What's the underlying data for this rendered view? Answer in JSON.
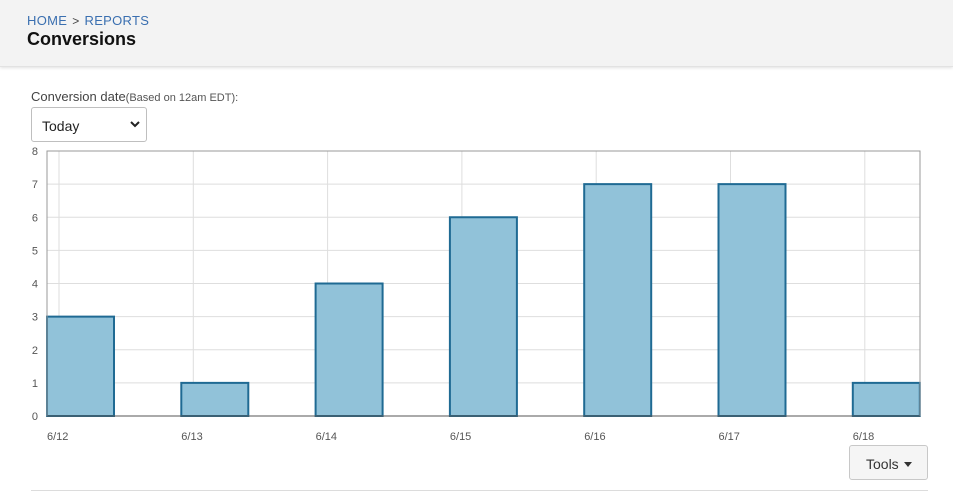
{
  "breadcrumb": {
    "home": "HOME",
    "separator": ">",
    "reports": "REPORTS"
  },
  "page": {
    "title": "Conversions"
  },
  "filter": {
    "label": "Conversion date",
    "note": "(Based on 12am EDT):",
    "selected": "Today"
  },
  "tools": {
    "label": "Tools"
  },
  "colors": {
    "bar_fill": "#91c2d9",
    "bar_stroke": "#1f6a93",
    "link": "#3a6fb0"
  },
  "chart_data": {
    "type": "bar",
    "categories": [
      "6/12",
      "6/13",
      "6/14",
      "6/15",
      "6/16",
      "6/17",
      "6/18"
    ],
    "values": [
      3,
      1,
      4,
      6,
      7,
      7,
      1
    ],
    "ylim": [
      0,
      8
    ],
    "yticks": [
      0,
      1,
      2,
      3,
      4,
      5,
      6,
      7,
      8
    ],
    "grid": true,
    "title": "",
    "xlabel": "",
    "ylabel": ""
  }
}
